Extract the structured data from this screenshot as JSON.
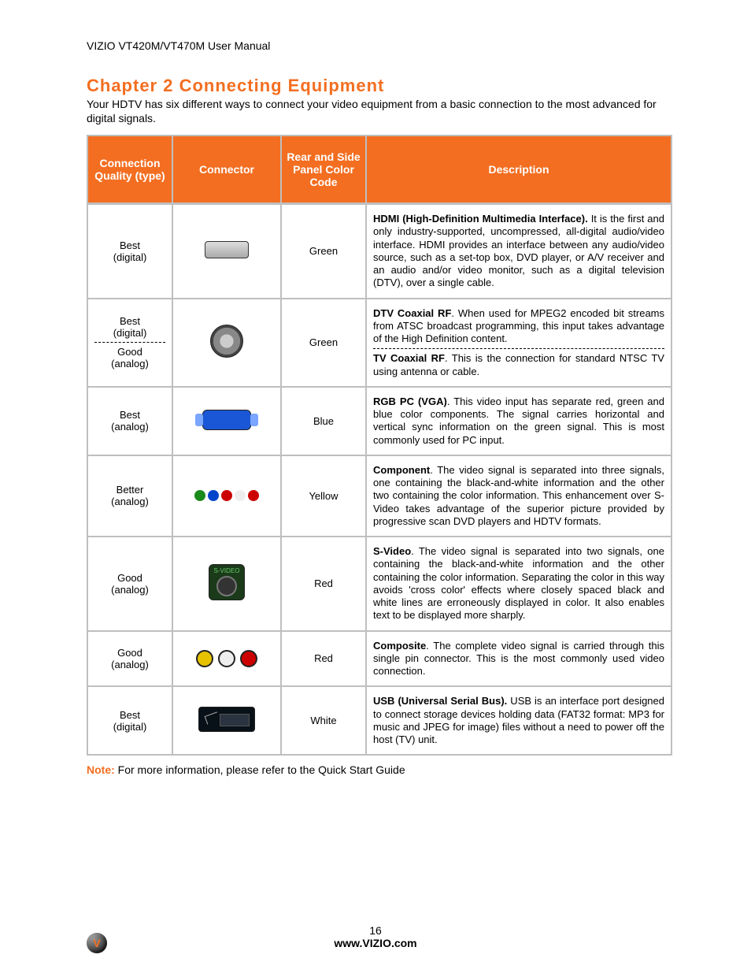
{
  "header": "VIZIO VT420M/VT470M User Manual",
  "chapter_title": "Chapter 2 Connecting Equipment",
  "intro": "Your HDTV has six different ways to connect your video equipment from a basic connection to the most advanced for digital signals.",
  "table": {
    "headers": {
      "quality": "Connection Quality (type)",
      "connector": "Connector",
      "color": "Rear and Side Panel Color Code",
      "description": "Description"
    },
    "rows": [
      {
        "quality_html": "Best<br>(digital)",
        "color": "Green",
        "icon": "hdmi",
        "desc_html": "<b>HDMI (High-Definition Multimedia Interface).</b> It is the first and only industry-supported, uncompressed, all-digital audio/video interface. HDMI provides an interface between any audio/video source, such as a set-top box, DVD player, or A/V receiver and an audio and/or video monitor, such as a digital television (DTV), over a single cable."
      },
      {
        "quality_html": "Best<br>(digital)<hr class='dash-sep'>Good<br>(analog)",
        "color": "Green",
        "icon": "coax",
        "desc_html": "<b>DTV Coaxial RF</b>.  When used for MPEG2 encoded bit streams from ATSC broadcast programming, this input takes advantage of the High Definition content.<hr class='dash-sep'><b>TV Coaxial RF</b>. This is the connection for standard NTSC TV using antenna or cable."
      },
      {
        "quality_html": "Best<br>(analog)",
        "color": "Blue",
        "icon": "vga",
        "desc_html": "<b>RGB PC (VGA)</b>. This video input has separate red, green and blue color components.  The signal carries horizontal and vertical sync information on the green signal.  This is most commonly used for PC input."
      },
      {
        "quality_html": "Better<br>(analog)",
        "color": "Yellow",
        "icon": "component",
        "desc_html": "<b>Component</b>. The video signal is separated into three signals, one containing the black-and-white information and the other two containing the color information. This enhancement over S-Video takes advantage of the superior picture provided by progressive scan DVD players and HDTV formats."
      },
      {
        "quality_html": "Good<br>(analog)",
        "color": "Red",
        "icon": "svideo",
        "desc_html": "<b>S-Video</b>. The video signal is separated into two signals, one containing the black-and-white information and the other containing the color information. Separating the color in this way avoids 'cross color' effects where closely spaced black and white lines are erroneously displayed in color. It also enables text to be displayed more sharply."
      },
      {
        "quality_html": "Good<br>(analog)",
        "color": "Red",
        "icon": "composite",
        "desc_html": "<b>Composite</b>. The complete video signal is carried through this single pin connector. This is the most commonly used video connection."
      },
      {
        "quality_html": "Best<br>(digital)",
        "color": "White",
        "icon": "usb",
        "desc_html": "<b>USB (Universal Serial Bus).</b> USB is an interface port designed to connect storage devices holding data (FAT32 format: MP3 for music and JPEG for image) files without a need to power off the host (TV) unit."
      }
    ]
  },
  "note_label": "Note:",
  "note_text": "  For more information, please refer to the Quick Start Guide",
  "footer": {
    "page": "16",
    "site": "www.VIZIO.com",
    "logo_letter": "V"
  }
}
